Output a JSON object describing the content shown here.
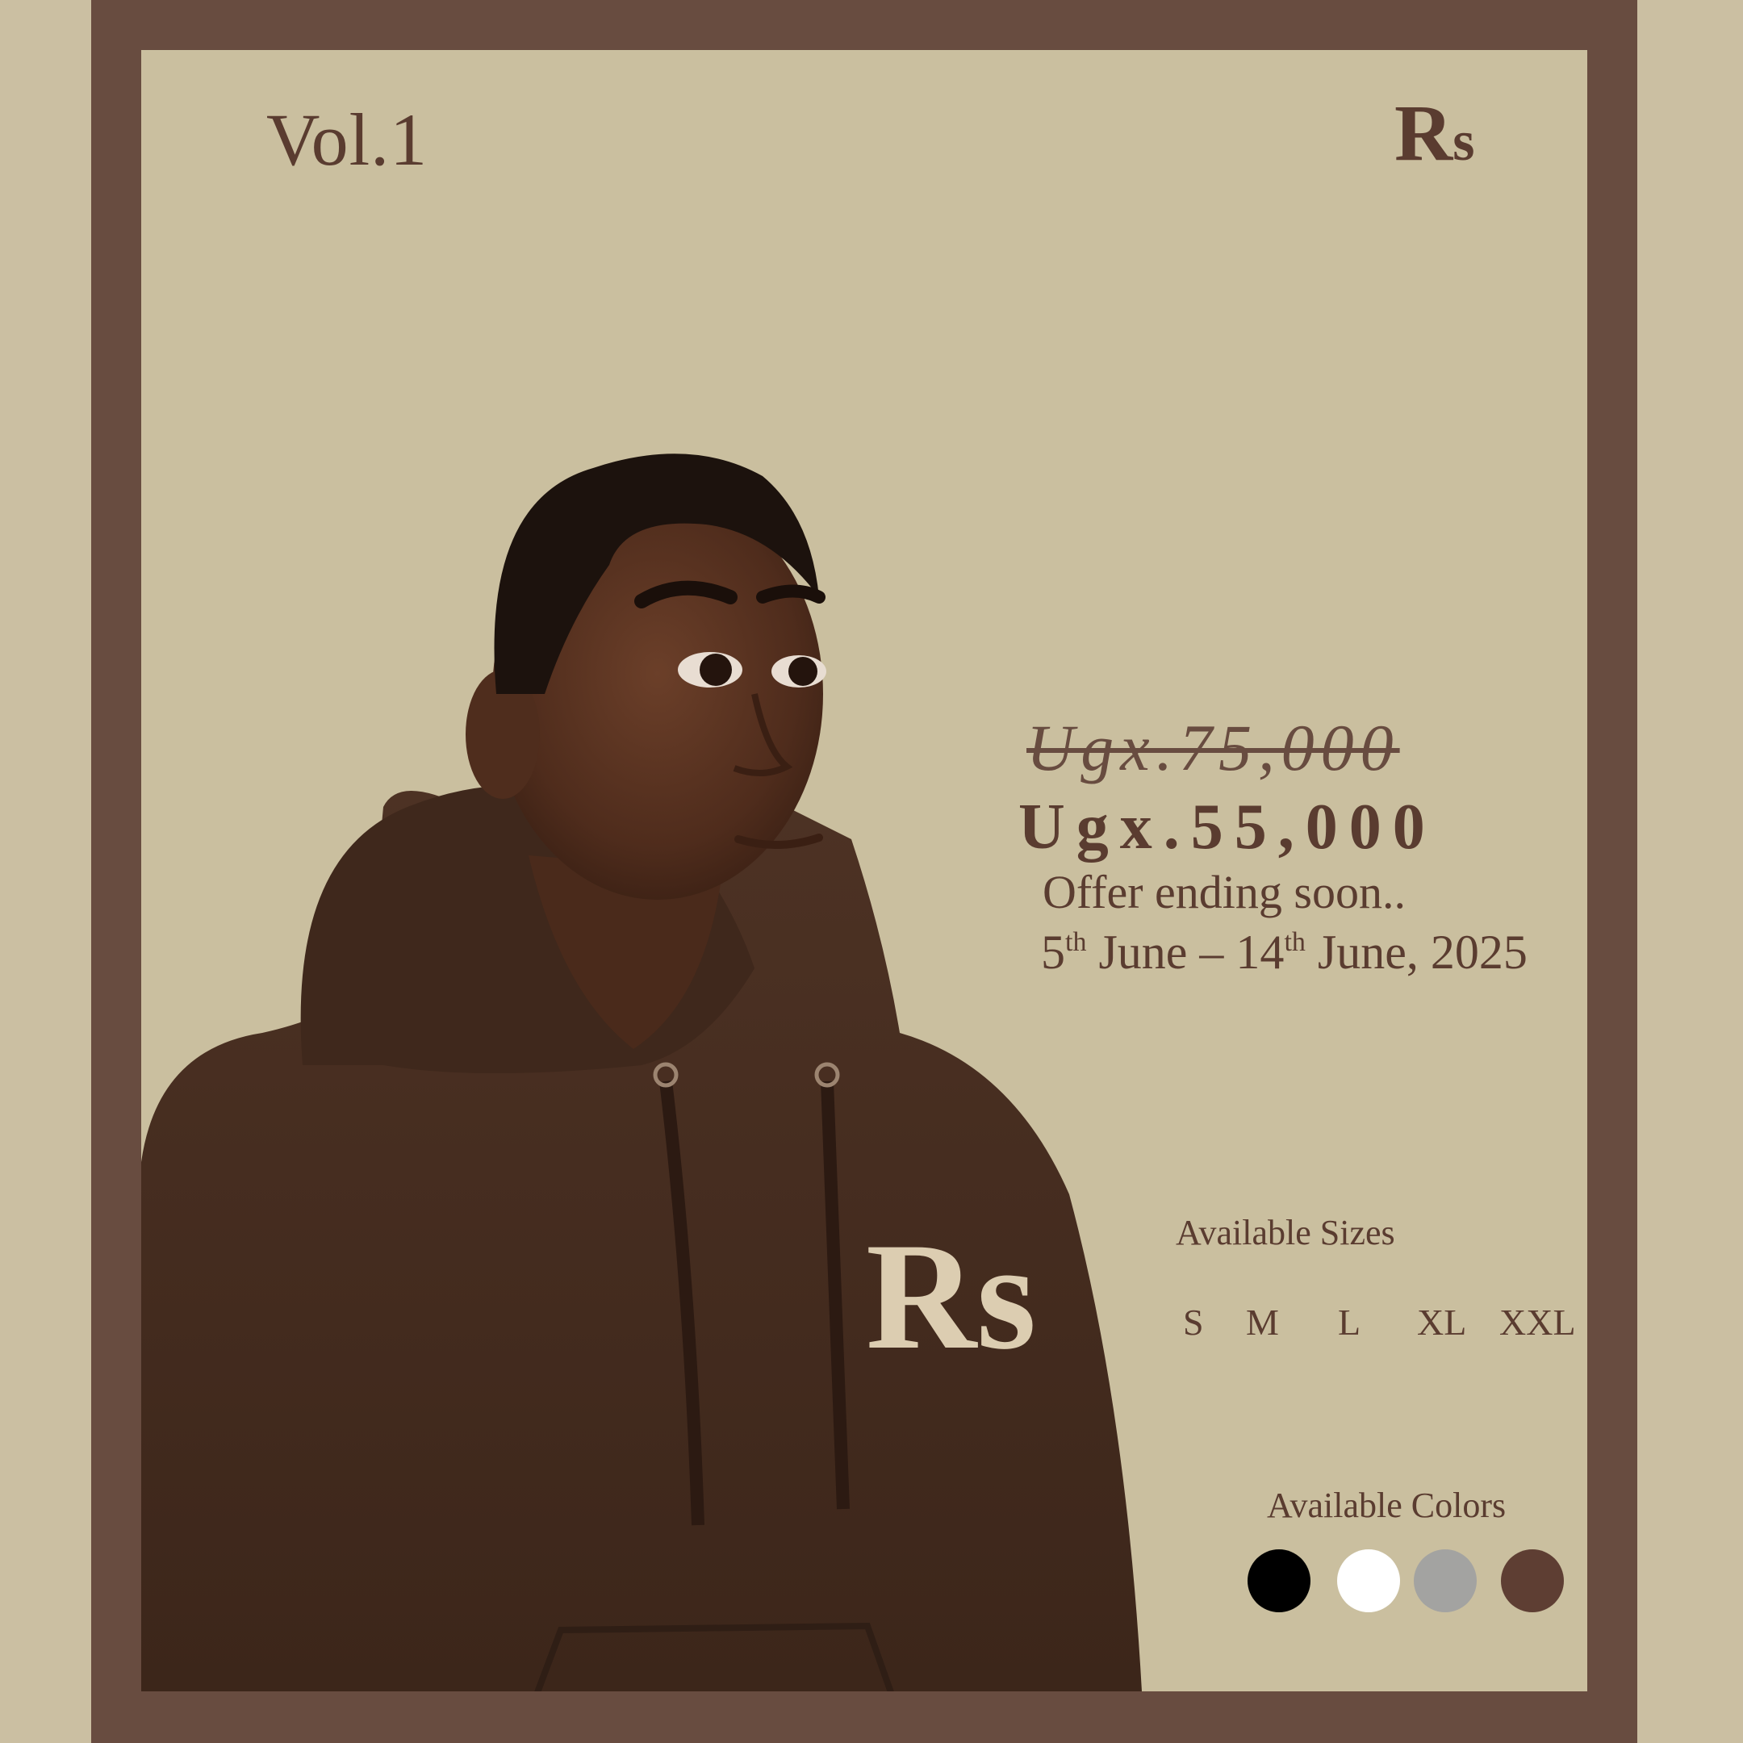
{
  "header": {
    "volume": "Vol.1",
    "brand_big": "R",
    "brand_small": "s"
  },
  "hoodie_logo": "Rs",
  "pricing": {
    "old_price": "Ugx.75,000",
    "new_price": "Ugx.55,000",
    "offer": "Offer ending soon..",
    "start_day": "5",
    "start_suffix": "th",
    "start_month": " June – 14",
    "end_suffix": "th",
    "end_rest": " June, 2025"
  },
  "sizes": {
    "title": "Available Sizes",
    "options": [
      "S",
      "M",
      "L",
      "XL",
      "XXL"
    ]
  },
  "colors": {
    "title": "Available Colors",
    "swatches": [
      {
        "name": "black",
        "hex": "#000000"
      },
      {
        "name": "white",
        "hex": "#ffffff"
      },
      {
        "name": "grey",
        "hex": "#a3a3a1"
      },
      {
        "name": "brown",
        "hex": "#5e3e33"
      }
    ]
  },
  "palette": {
    "background": "#cbbfa2",
    "frame": "#684c40",
    "text": "#5a3c30",
    "hoodie": "#4a3022"
  }
}
